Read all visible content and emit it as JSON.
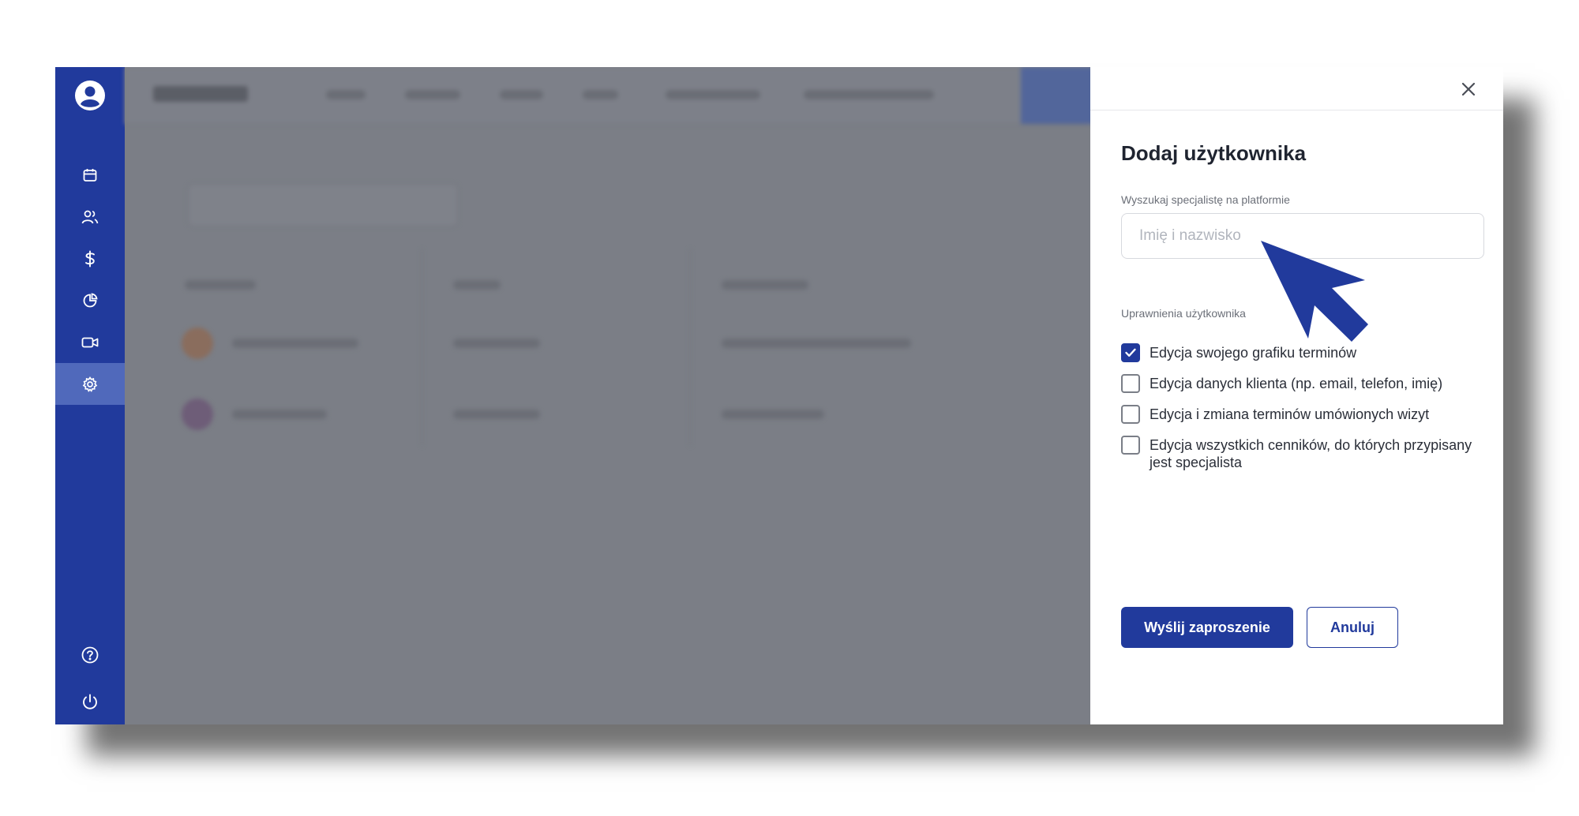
{
  "dialog": {
    "title": "Dodaj użytkownika",
    "search_label": "Wyszukaj specjalistę na platformie",
    "search_placeholder": "Imię i nazwisko",
    "search_value": "",
    "permissions_label": "Uprawnienia użytkownika",
    "permissions": [
      {
        "label": "Edycja swojego grafiku terminów",
        "checked": true
      },
      {
        "label": "Edycja danych klienta (np. email, telefon, imię)",
        "checked": false
      },
      {
        "label": "Edycja i zmiana terminów umówionych wizyt",
        "checked": false
      },
      {
        "label": "Edycja wszystkich cenników, do których przypisany jest specjalista",
        "checked": false
      }
    ],
    "primary_button": "Wyślij zaproszenie",
    "secondary_button": "Anuluj",
    "close_icon": "close-icon"
  },
  "sidebar": {
    "top_icon": "user-avatar-icon",
    "items": [
      {
        "icon": "calendar-icon",
        "active": false
      },
      {
        "icon": "users-icon",
        "active": false
      },
      {
        "icon": "dollar-icon",
        "active": false
      },
      {
        "icon": "pie-chart-icon",
        "active": false
      },
      {
        "icon": "video-icon",
        "active": false
      },
      {
        "icon": "settings-icon",
        "active": true
      }
    ],
    "bottom_items": [
      {
        "icon": "help-icon"
      },
      {
        "icon": "power-icon"
      }
    ]
  },
  "colors": {
    "brand": "#213a9c",
    "sidebar_active": "#5069bb",
    "overlay": "#7b7e86"
  }
}
